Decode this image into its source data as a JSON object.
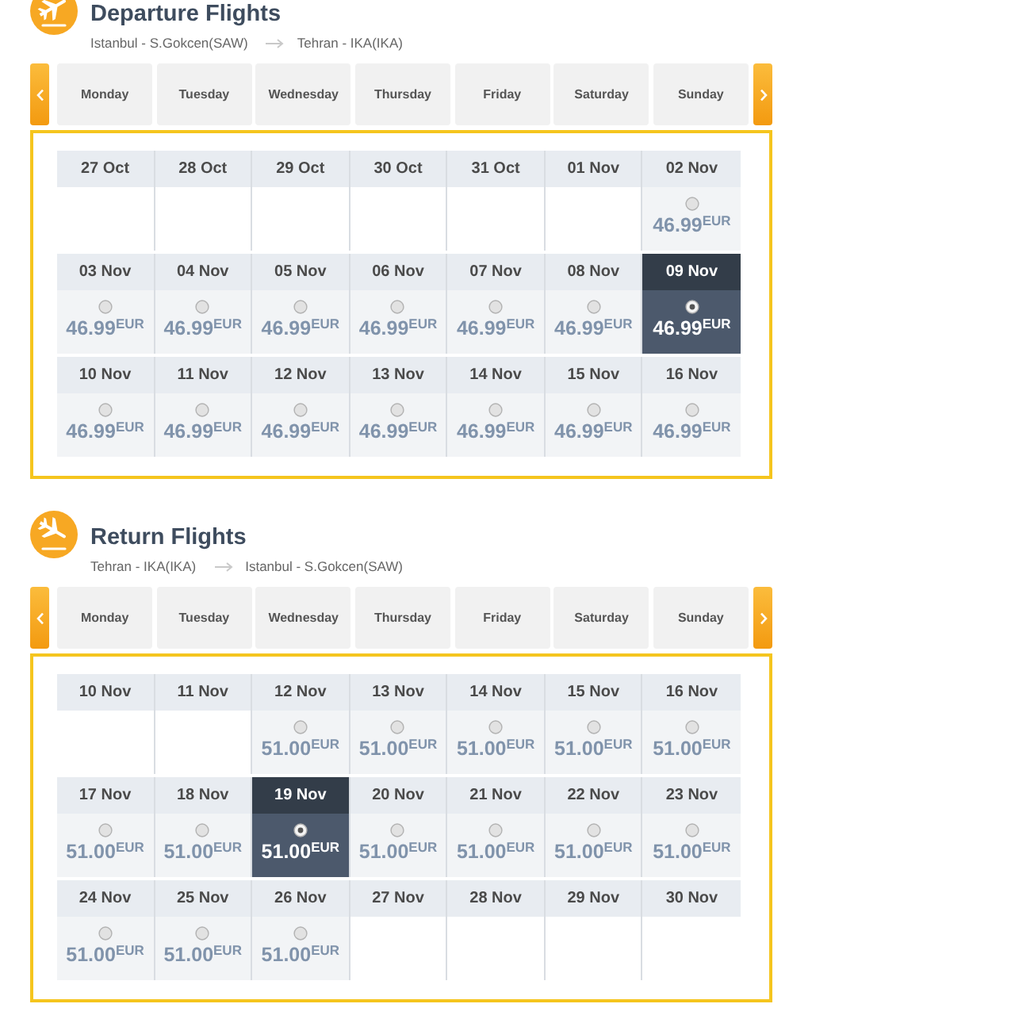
{
  "sections": [
    {
      "kind": "departure",
      "title": "Departure Flights",
      "origin": "Istanbul - S.Gokcen(SAW)",
      "destination": "Tehran - IKA(IKA)",
      "days": [
        "Monday",
        "Tuesday",
        "Wednesday",
        "Thursday",
        "Friday",
        "Saturday",
        "Sunday"
      ],
      "weeks": [
        [
          {
            "date": "27 Oct",
            "selected": false
          },
          {
            "date": "28 Oct",
            "selected": false
          },
          {
            "date": "29 Oct",
            "selected": false
          },
          {
            "date": "30 Oct",
            "selected": false
          },
          {
            "date": "31 Oct",
            "selected": false
          },
          {
            "date": "01 Nov",
            "selected": false
          },
          {
            "date": "02 Nov",
            "price": "46.99$^{EUR}$",
            "selected": false
          }
        ],
        [
          {
            "date": "03 Nov",
            "price": "46.99$^{EUR}$",
            "selected": false
          },
          {
            "date": "04 Nov",
            "price": "46.99$^{EUR}$",
            "selected": false
          },
          {
            "date": "05 Nov",
            "price": "46.99$^{EUR}$",
            "selected": false
          },
          {
            "date": "06 Nov",
            "price": "46.99$^{EUR}$",
            "selected": false
          },
          {
            "date": "07 Nov",
            "price": "46.99$^{EUR}$",
            "selected": false
          },
          {
            "date": "08 Nov",
            "price": "46.99$^{EUR}$",
            "selected": false
          },
          {
            "date": "09 Nov",
            "price": "46.99$^{EUR}$",
            "selected": true
          }
        ],
        [
          {
            "date": "10 Nov",
            "price": "46.99$^{EUR}$",
            "selected": false
          },
          {
            "date": "11 Nov",
            "price": "46.99$^{EUR}$",
            "selected": false
          },
          {
            "date": "12 Nov",
            "price": "46.99$^{EUR}$",
            "selected": false
          },
          {
            "date": "13 Nov",
            "price": "46.99$^{EUR}$",
            "selected": false
          },
          {
            "date": "14 Nov",
            "price": "46.99$^{EUR}$",
            "selected": false
          },
          {
            "date": "15 Nov",
            "price": "46.99$^{EUR}$",
            "selected": false
          },
          {
            "date": "16 Nov",
            "price": "46.99$^{EUR}$",
            "selected": false
          }
        ]
      ]
    },
    {
      "kind": "return",
      "title": "Return Flights",
      "origin": "Tehran - IKA(IKA)",
      "destination": "Istanbul - S.Gokcen(SAW)",
      "days": [
        "Monday",
        "Tuesday",
        "Wednesday",
        "Thursday",
        "Friday",
        "Saturday",
        "Sunday"
      ],
      "weeks": [
        [
          {
            "date": "10 Nov",
            "selected": false
          },
          {
            "date": "11 Nov",
            "selected": false
          },
          {
            "date": "12 Nov",
            "price": "51.00$^{EUR}$",
            "selected": false
          },
          {
            "date": "13 Nov",
            "price": "51.00$^{EUR}$",
            "selected": false
          },
          {
            "date": "14 Nov",
            "price": "51.00$^{EUR}$",
            "selected": false
          },
          {
            "date": "15 Nov",
            "price": "51.00$^{EUR}$",
            "selected": false
          },
          {
            "date": "16 Nov",
            "price": "51.00$^{EUR}$",
            "selected": false
          }
        ],
        [
          {
            "date": "17 Nov",
            "price": "51.00$^{EUR}$",
            "selected": false
          },
          {
            "date": "18 Nov",
            "price": "51.00$^{EUR}$",
            "selected": false
          },
          {
            "date": "19 Nov",
            "price": "51.00$^{EUR}$",
            "selected": true
          },
          {
            "date": "20 Nov",
            "price": "51.00$^{EUR}$",
            "selected": false
          },
          {
            "date": "21 Nov",
            "price": "51.00$^{EUR}$",
            "selected": false
          },
          {
            "date": "22 Nov",
            "price": "51.00$^{EUR}$",
            "selected": false
          },
          {
            "date": "23 Nov",
            "price": "51.00$^{EUR}$",
            "selected": false
          }
        ],
        [
          {
            "date": "24 Nov",
            "price": "51.00$^{EUR}$",
            "selected": false
          },
          {
            "date": "25 Nov",
            "price": "51.00$^{EUR}$",
            "selected": false
          },
          {
            "date": "26 Nov",
            "price": "51.00$^{EUR}$",
            "selected": false
          },
          {
            "date": "27 Nov",
            "selected": false
          },
          {
            "date": "28 Nov",
            "selected": false
          },
          {
            "date": "29 Nov",
            "selected": false
          },
          {
            "date": "30 Nov",
            "selected": false
          }
        ]
      ]
    }
  ]
}
